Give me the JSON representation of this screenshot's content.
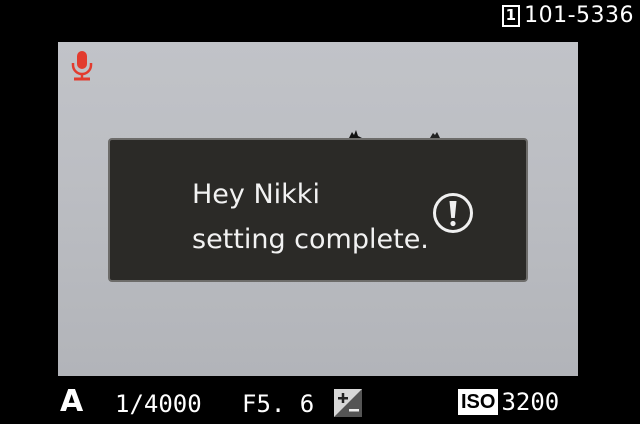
{
  "top_bar": {
    "card_slot": "1",
    "file_number": "101-5336"
  },
  "viewfinder": {
    "mic_icon": "microphone-icon",
    "dialog": {
      "line1": "Hey Nikki",
      "line2": "setting complete.",
      "icon": "exclamation-circle-icon"
    }
  },
  "bottom_bar": {
    "mode": "A",
    "shutter_speed": "1/4000",
    "aperture": "F5. 6",
    "exposure_comp_icon": "exposure-compensation-icon",
    "iso_label": "ISO",
    "iso_value": "3200"
  },
  "colors": {
    "mic": "#e23b2e",
    "dialog_bg": "#2b2a27",
    "sky": "#bcbec3"
  }
}
